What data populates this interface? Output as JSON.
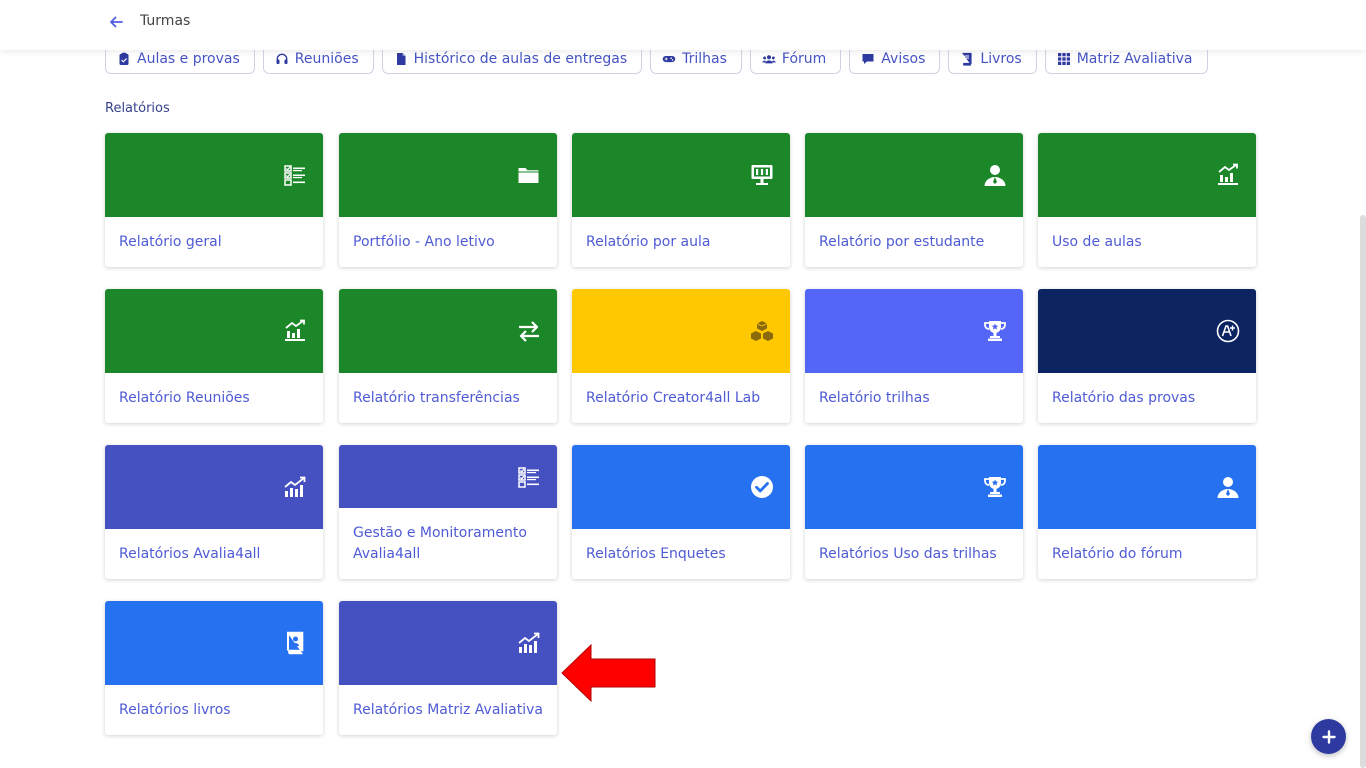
{
  "header": {
    "title": "Turmas"
  },
  "tabs": [
    {
      "label": "Aulas e provas",
      "icon": "clipboard-icon"
    },
    {
      "label": "Reuniões",
      "icon": "headset-icon"
    },
    {
      "label": "Histórico de aulas de entregas",
      "icon": "file-icon"
    },
    {
      "label": "Trilhas",
      "icon": "gamepad-icon"
    },
    {
      "label": "Fórum",
      "icon": "users-icon"
    },
    {
      "label": "Avisos",
      "icon": "comment-icon"
    },
    {
      "label": "Livros",
      "icon": "book-icon"
    },
    {
      "label": "Matriz Avaliativa",
      "icon": "grid-icon"
    }
  ],
  "section": {
    "title": "Relatórios"
  },
  "cards": [
    {
      "label": "Relatório geral",
      "icon": "checklist-icon",
      "color": "#1b8728"
    },
    {
      "label": "Portfólio - Ano letivo",
      "icon": "folder-icon",
      "color": "#1b8728"
    },
    {
      "label": "Relatório por aula",
      "icon": "presentation-icon",
      "color": "#1b8728"
    },
    {
      "label": "Relatório por estudante",
      "icon": "student-icon",
      "color": "#1b8728"
    },
    {
      "label": "Uso de aulas",
      "icon": "chart-up-icon",
      "color": "#1b8728"
    },
    {
      "label": "Relatório Reuniões",
      "icon": "chart-up-icon",
      "color": "#1b8728"
    },
    {
      "label": "Relatório transferências",
      "icon": "exchange-icon",
      "color": "#1b8728"
    },
    {
      "label": "Relatório Creator4all Lab",
      "icon": "cubes-icon",
      "color": "#ffc800"
    },
    {
      "label": "Relatório trilhas",
      "icon": "trophy-icon",
      "color": "#5466f5"
    },
    {
      "label": "Relatório das provas",
      "icon": "grade-a-plus-icon",
      "color": "#0d2462"
    },
    {
      "label": "Relatórios Avalia4all",
      "icon": "bar-chart-icon",
      "color": "#4550c1"
    },
    {
      "label": "Gestão e Monitoramento Avalia4all",
      "icon": "checklist-icon",
      "color": "#4550c1"
    },
    {
      "label": "Relatórios Enquetes",
      "icon": "check-circle-icon",
      "color": "#2671f0"
    },
    {
      "label": "Relatórios Uso das trilhas",
      "icon": "trophy-icon",
      "color": "#2671f0"
    },
    {
      "label": "Relatório do fórum",
      "icon": "student-icon",
      "color": "#2671f0"
    },
    {
      "label": "Relatórios livros",
      "icon": "book-bookmark-icon",
      "color": "#2671f0"
    },
    {
      "label": "Relatórios Matriz Avaliativa",
      "icon": "bar-chart-icon",
      "color": "#4550c1"
    }
  ],
  "annotation": {
    "color": "#ff0000"
  },
  "fab": {
    "icon": "plus-icon"
  }
}
